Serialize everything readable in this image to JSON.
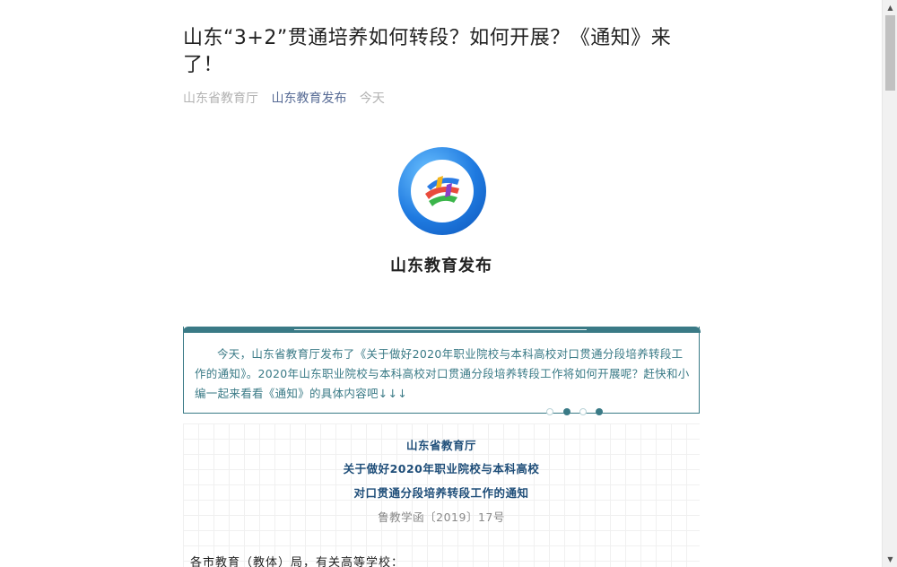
{
  "article": {
    "title": "山东“3+2”贯通培养如何转段？如何开展？《通知》来了！",
    "meta": {
      "org": "山东省教育厅",
      "account": "山东教育发布",
      "date": "今天"
    }
  },
  "logo": {
    "name": "山东教育发布"
  },
  "intro": {
    "text": "今天，山东省教育厅发布了《关于做好2020年职业院校与本科高校对口贯通分段培养转段工作的通知》。2020年山东职业院校与本科高校对口贯通分段培养转段工作将如何开展呢？赶快和小编一起来看看《通知》的具体内容吧↓↓↓",
    "accent_color": "#3a7a86"
  },
  "notice": {
    "line1": "山东省教育厅",
    "line2": "关于做好2020年职业院校与本科高校",
    "line3": "对口贯通分段培养转段工作的通知",
    "doc_number": "鲁教学函〔2019〕17号",
    "salutation": "各市教育（教体）局，有关高等学校："
  },
  "colors": {
    "link": "#576b95",
    "meta_gray": "#b2b2b2",
    "notice_blue": "#1f4e79"
  },
  "icons": {
    "scroll_up": "triangle-up-icon",
    "scroll_down": "triangle-down-icon",
    "logo": "shandong-education-logo-icon"
  }
}
